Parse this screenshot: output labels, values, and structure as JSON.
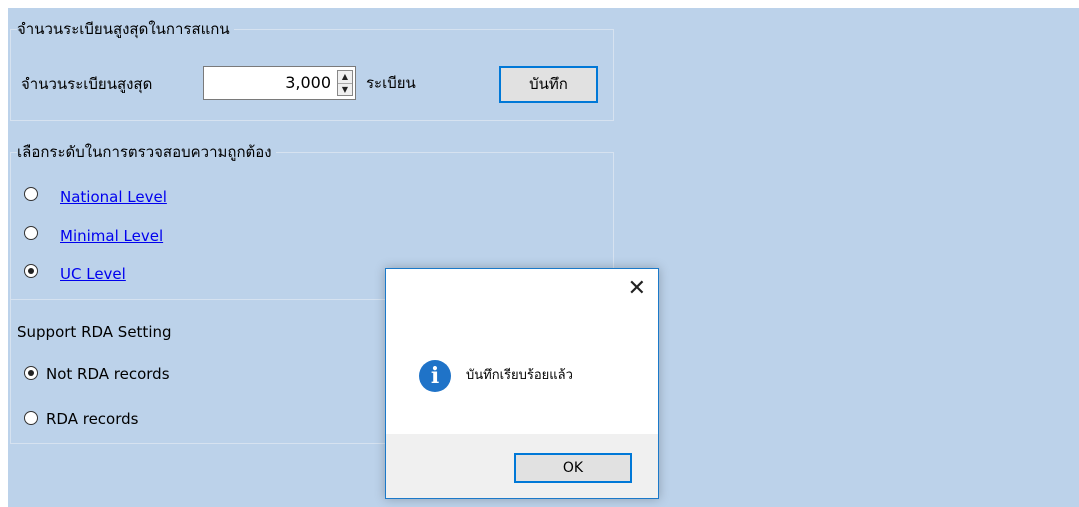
{
  "scan": {
    "legend": "จำนวนระเบียนสูงสุดในการสแกน",
    "label": "จำนวนระเบียนสูงสุด",
    "value": "3,000",
    "unit": "ระเบียน",
    "save_label": "บันทึก"
  },
  "validation": {
    "legend": "เลือกระดับในการตรวจสอบความถูกต้อง",
    "options": [
      {
        "label": "National Level",
        "selected": false
      },
      {
        "label": "Minimal Level",
        "selected": false
      },
      {
        "label": "UC Level",
        "selected": true
      }
    ]
  },
  "rda": {
    "legend": "Support RDA Setting",
    "options": [
      {
        "label": "Not RDA records",
        "selected": true
      },
      {
        "label": "RDA records",
        "selected": false
      }
    ]
  },
  "dialog": {
    "message": "บันทึกเรียบร้อยแล้ว",
    "ok_label": "OK",
    "icon": "info-icon",
    "close_icon": "close-icon"
  },
  "colors": {
    "panel_bg": "#bcd2ea",
    "accent": "#0078d7",
    "link": "#0000ee",
    "info": "#1f73c8"
  }
}
